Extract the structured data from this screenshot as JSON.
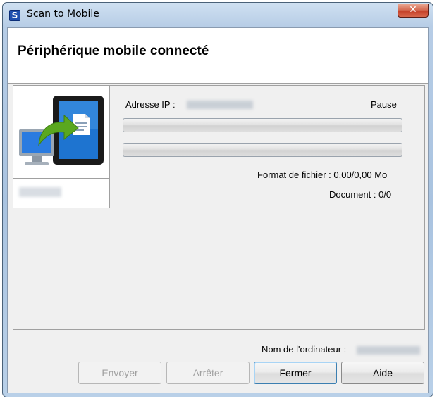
{
  "window": {
    "title": "Scan to Mobile",
    "icon": "scan-to-mobile-app-icon",
    "close_glyph": "✕"
  },
  "header": {
    "title": "Périphérique mobile connecté"
  },
  "device": {
    "image_icon": "computer-to-tablet-icon"
  },
  "status": {
    "ip_label": "Adresse IP :",
    "state": "Pause",
    "file_format": "Format de fichier : 0,00/0,00 Mo",
    "document": "Document : 0/0"
  },
  "footer": {
    "computer_name_label": "Nom de l'ordinateur :"
  },
  "buttons": {
    "send": "Envoyer",
    "stop": "Arrêter",
    "close": "Fermer",
    "help": "Aide"
  },
  "colors": {
    "accent": "#1f4fae",
    "close_button": "#c5412a",
    "arrow": "#5aa81f"
  }
}
